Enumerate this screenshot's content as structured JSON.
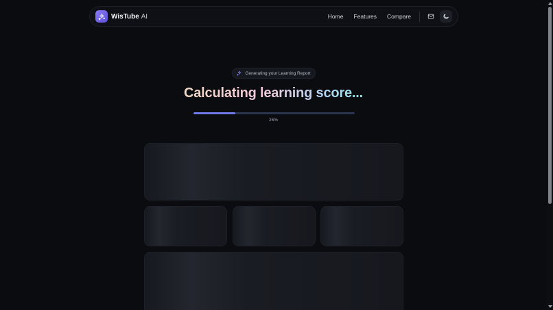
{
  "header": {
    "brand_name": "WisTube",
    "brand_suffix": "AI",
    "nav": [
      {
        "label": "Home"
      },
      {
        "label": "Features"
      },
      {
        "label": "Compare"
      }
    ],
    "icons": {
      "logo": "sparkles-icon",
      "mail": "mail-icon",
      "theme": "moon-icon"
    },
    "accent": "#6f79e8"
  },
  "status": {
    "badge_text": "Generating your Learning Report",
    "title": "Calculating learning score...",
    "progress": 0.26,
    "percent_label": "26%"
  }
}
